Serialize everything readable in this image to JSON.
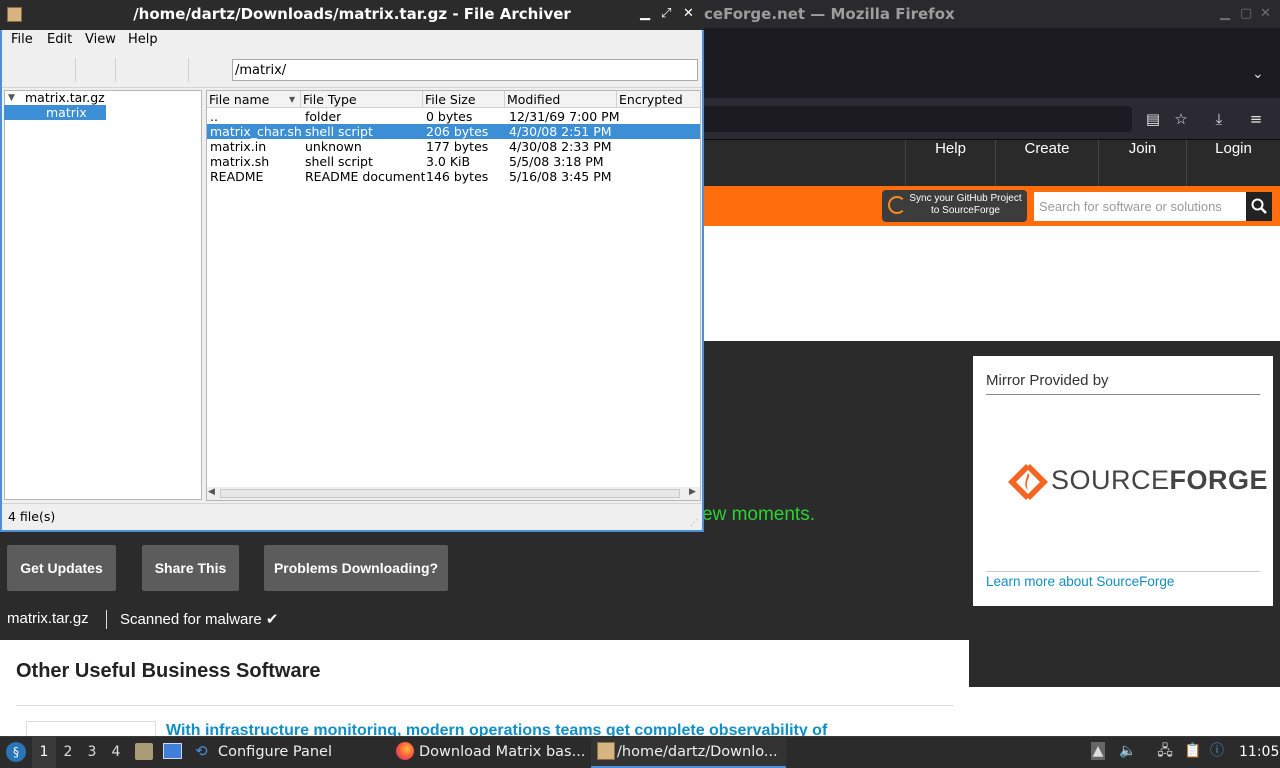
{
  "firefox": {
    "window_title": "ceForge.net — Mozilla Firefox",
    "toolbar_icons": [
      "reader-view-icon",
      "bookmark-star-icon",
      "downloads-icon",
      "menu-icon"
    ]
  },
  "sourceforge": {
    "nav": [
      "Help",
      "Create",
      "Join",
      "Login"
    ],
    "sync_line1": "Sync your GitHub Project",
    "sync_line2": "to SourceForge",
    "search_placeholder": "Search for software or solutions",
    "green_text": "ew moments.",
    "mirror_title": "Mirror Provided by",
    "logo_text_light": "SOURCE",
    "logo_text_bold": "FORGE",
    "mirror_link": "Learn more about SourceForge",
    "buttons": [
      "Get Updates",
      "Share This",
      "Problems Downloading?"
    ],
    "file_name": "matrix.tar.gz",
    "scan_status": "Scanned for malware ✔",
    "other_title": "Other Useful Business Software",
    "other_link": "With infrastructure monitoring, modern operations teams get complete observability of",
    "colors": {
      "orange": "#ff6d0d",
      "link": "#0f8fc5",
      "green": "#2ad232"
    }
  },
  "archiver": {
    "title": "/home/dartz/Downloads/matrix.tar.gz - File Archiver",
    "menu": [
      "File",
      "Edit",
      "View",
      "Help"
    ],
    "location": "/matrix/",
    "tree": {
      "root": "matrix.tar.gz",
      "child": "matrix"
    },
    "columns": [
      "File name",
      "File Type",
      "File Size",
      "Modified",
      "Encrypted"
    ],
    "rows": [
      {
        "name": "..",
        "type": "folder",
        "size": "0 bytes",
        "modified": "12/31/69 7:00 PM",
        "selected": false
      },
      {
        "name": "matrix_char.sh",
        "type": "shell script",
        "size": "206 bytes",
        "modified": "4/30/08 2:51 PM",
        "selected": true
      },
      {
        "name": "matrix.in",
        "type": "unknown",
        "size": "177 bytes",
        "modified": "4/30/08 2:33 PM",
        "selected": false
      },
      {
        "name": "matrix.sh",
        "type": "shell script",
        "size": "3.0 KiB",
        "modified": "5/5/08 3:18 PM",
        "selected": false
      },
      {
        "name": "README",
        "type": "README document",
        "size": "146 bytes",
        "modified": "5/16/08 3:45 PM",
        "selected": false
      }
    ],
    "status": "4 file(s)",
    "selection_color": "#3c8ed5"
  },
  "taskbar": {
    "workspaces": [
      "1",
      "2",
      "3",
      "4"
    ],
    "tasks": [
      "Configure Panel",
      "Download Matrix bas...",
      "/home/dartz/Downlo..."
    ],
    "clock": "11:05"
  }
}
